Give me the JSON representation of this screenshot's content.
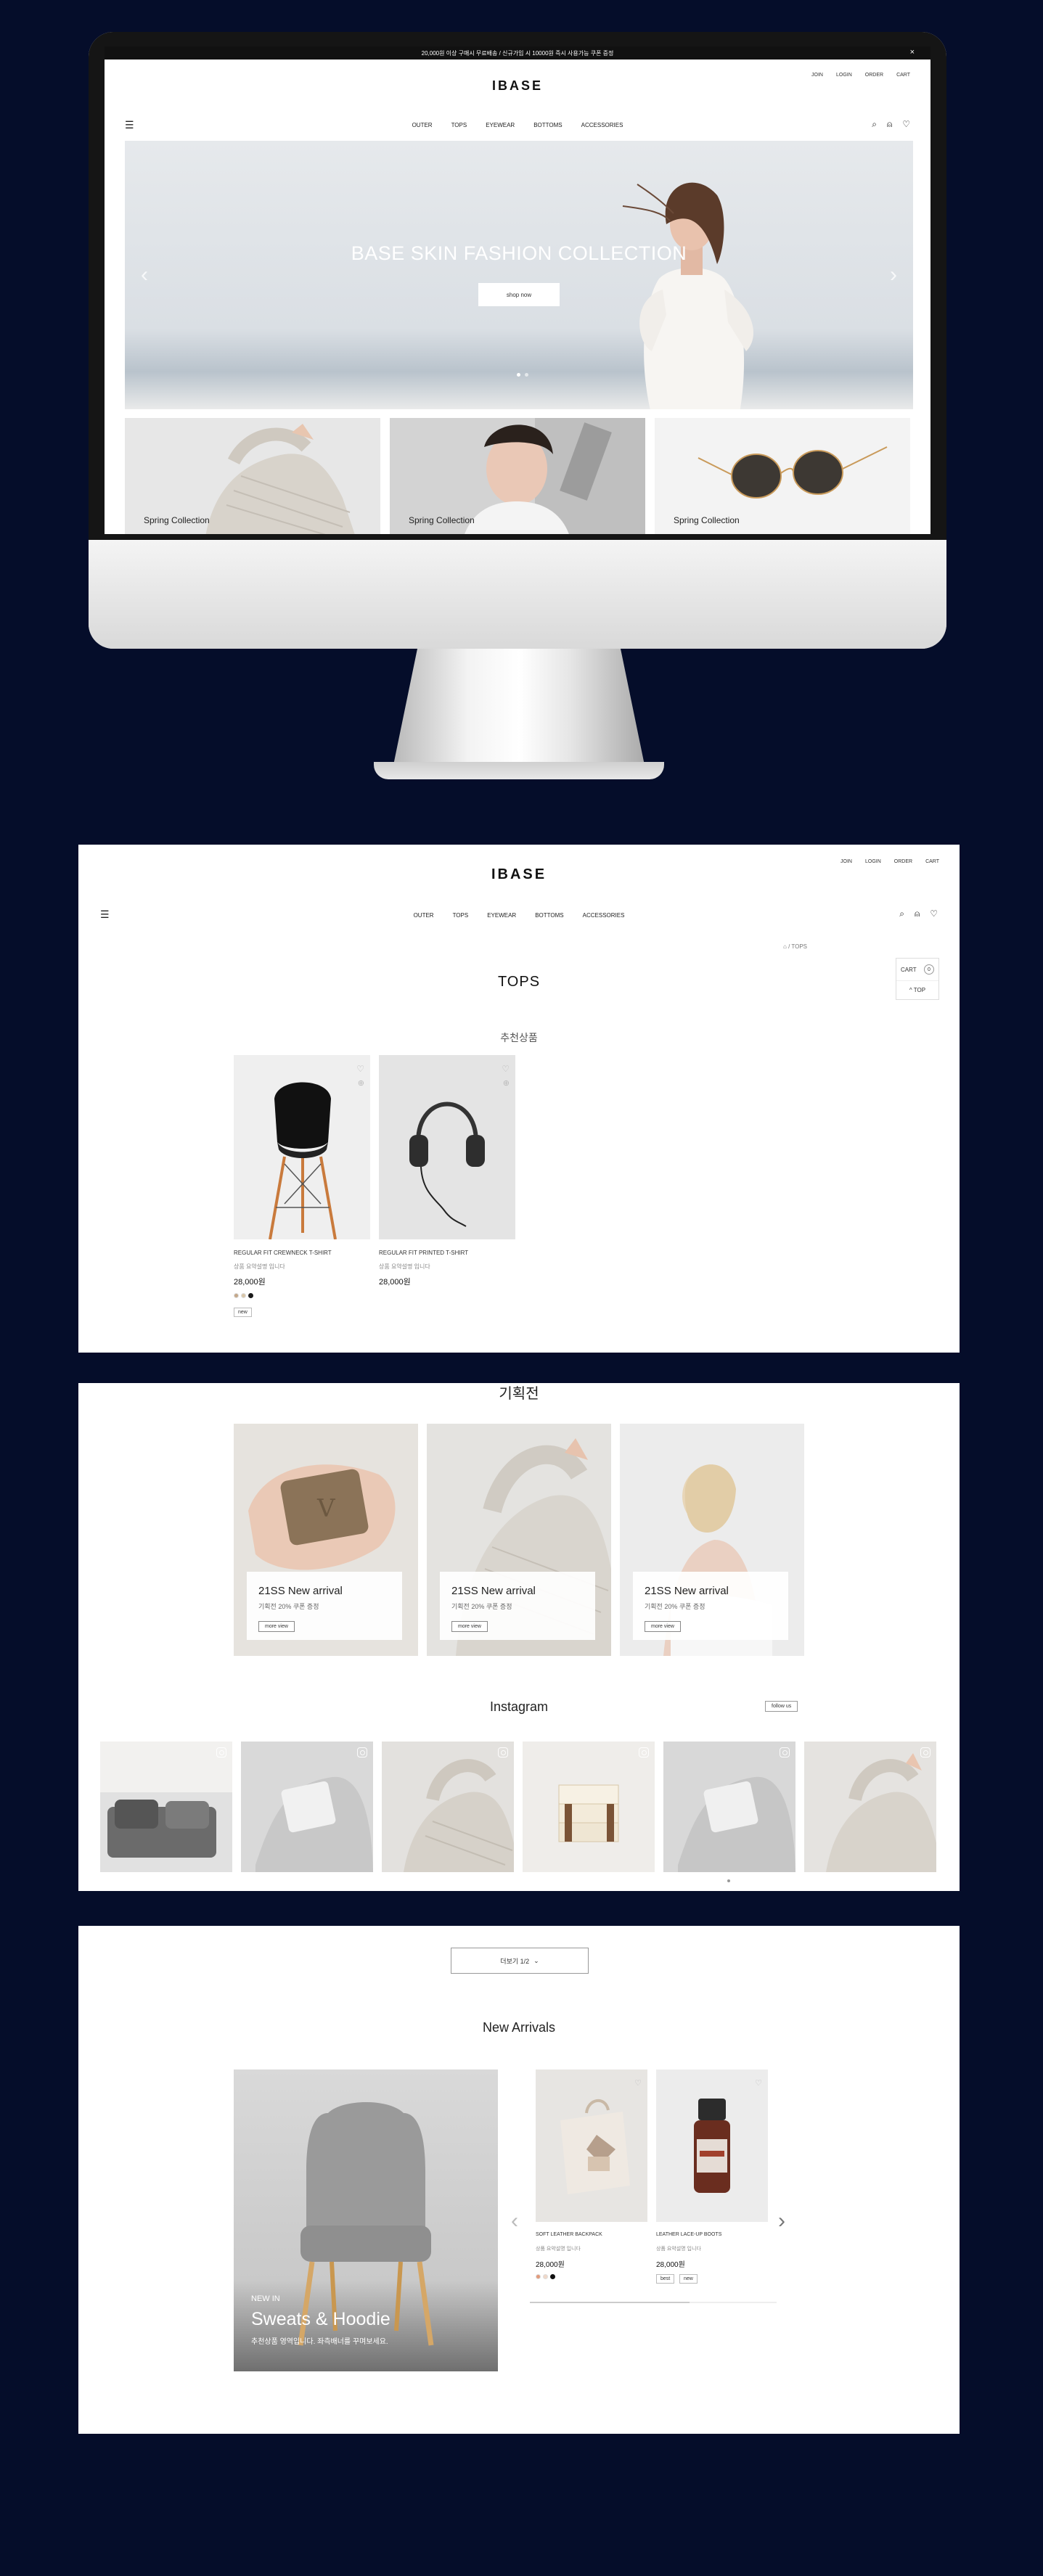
{
  "monitor_screen": {
    "topbar": {
      "notice": "20,000원 이상 구매시 무료배송 / 신규가입 시 10000원 즉시 사용가능 쿠폰 증정",
      "close": "×"
    },
    "util_links": [
      "JOIN",
      "LOGIN",
      "ORDER",
      "CART"
    ],
    "logo": "IBASE",
    "gnb": [
      "OUTER",
      "TOPS",
      "EYEWEAR",
      "BOTTOMS",
      "ACCESSORIES"
    ],
    "hero": {
      "title": "BASE SKIN FASHION COLLECTION",
      "button": "shop now",
      "prev": "‹",
      "next": "›"
    },
    "categories": [
      {
        "label": "Spring Collection"
      },
      {
        "label": "Spring Collection"
      },
      {
        "label": "Spring Collection"
      }
    ]
  },
  "category_page": {
    "util_links": [
      "JOIN",
      "LOGIN",
      "ORDER",
      "CART"
    ],
    "logo": "IBASE",
    "gnb": [
      "OUTER",
      "TOPS",
      "EYEWEAR",
      "BOTTOMS",
      "ACCESSORIES"
    ],
    "breadcrumb": "/ TOPS",
    "page_title": "TOPS",
    "section_title": "추천상품",
    "quick": {
      "cart": "CART",
      "cart_count": "0",
      "top": "^ TOP"
    },
    "products": [
      {
        "name": "REGULAR FIT CREWNECK T-SHIRT",
        "desc": "상품 요약설명 입니다",
        "price": "28,000원",
        "tag": "new",
        "swatches": [
          "#c5a88a",
          "#d9c6a8",
          "#1a1a1a"
        ]
      },
      {
        "name": "REGULAR FIT PRINTED T-SHIRT",
        "desc": "상품 요약설명 입니다",
        "price": "28,000원"
      }
    ]
  },
  "promo_section": {
    "title": "기획전",
    "promos": [
      {
        "title": "21SS New arrival",
        "sub": "기획전 20% 쿠폰 증정",
        "button": "more view"
      },
      {
        "title": "21SS New arrival",
        "sub": "기획전 20% 쿠폰 증정",
        "button": "more view"
      },
      {
        "title": "21SS New arrival",
        "sub": "기획전 20% 쿠폰 증정",
        "button": "more view"
      }
    ],
    "instagram": {
      "title": "Instagram",
      "follow": "follow us"
    }
  },
  "arrivals_section": {
    "more_button": "더보기 1/2",
    "title": "New Arrivals",
    "feature": {
      "eyebrow": "NEW IN",
      "title": "Sweats & Hoodie",
      "sub": "추천상품 영역입니다. 좌측배너를 꾸며보세요."
    },
    "products": [
      {
        "name": "SOFT LEATHER BACKPACK",
        "desc": "상품 요약설명 입니다",
        "price": "28,000원",
        "swatches": [
          "#e39a7a",
          "#f0d8c8",
          "#111111"
        ]
      },
      {
        "name": "LEATHER LACE-UP BOOTS",
        "desc": "상품 요약설명 입니다",
        "price": "28,000원",
        "tags": [
          "best",
          "new"
        ]
      }
    ],
    "prev": "‹",
    "next": "›"
  }
}
